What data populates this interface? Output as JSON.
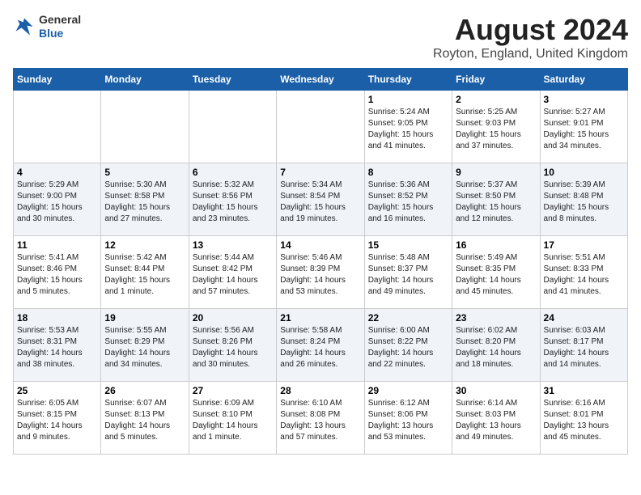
{
  "header": {
    "logo_general": "General",
    "logo_blue": "Blue",
    "title": "August 2024",
    "subtitle": "Royton, England, United Kingdom"
  },
  "days_of_week": [
    "Sunday",
    "Monday",
    "Tuesday",
    "Wednesday",
    "Thursday",
    "Friday",
    "Saturday"
  ],
  "weeks": [
    [
      {
        "num": "",
        "info": ""
      },
      {
        "num": "",
        "info": ""
      },
      {
        "num": "",
        "info": ""
      },
      {
        "num": "",
        "info": ""
      },
      {
        "num": "1",
        "info": "Sunrise: 5:24 AM\nSunset: 9:05 PM\nDaylight: 15 hours\nand 41 minutes."
      },
      {
        "num": "2",
        "info": "Sunrise: 5:25 AM\nSunset: 9:03 PM\nDaylight: 15 hours\nand 37 minutes."
      },
      {
        "num": "3",
        "info": "Sunrise: 5:27 AM\nSunset: 9:01 PM\nDaylight: 15 hours\nand 34 minutes."
      }
    ],
    [
      {
        "num": "4",
        "info": "Sunrise: 5:29 AM\nSunset: 9:00 PM\nDaylight: 15 hours\nand 30 minutes."
      },
      {
        "num": "5",
        "info": "Sunrise: 5:30 AM\nSunset: 8:58 PM\nDaylight: 15 hours\nand 27 minutes."
      },
      {
        "num": "6",
        "info": "Sunrise: 5:32 AM\nSunset: 8:56 PM\nDaylight: 15 hours\nand 23 minutes."
      },
      {
        "num": "7",
        "info": "Sunrise: 5:34 AM\nSunset: 8:54 PM\nDaylight: 15 hours\nand 19 minutes."
      },
      {
        "num": "8",
        "info": "Sunrise: 5:36 AM\nSunset: 8:52 PM\nDaylight: 15 hours\nand 16 minutes."
      },
      {
        "num": "9",
        "info": "Sunrise: 5:37 AM\nSunset: 8:50 PM\nDaylight: 15 hours\nand 12 minutes."
      },
      {
        "num": "10",
        "info": "Sunrise: 5:39 AM\nSunset: 8:48 PM\nDaylight: 15 hours\nand 8 minutes."
      }
    ],
    [
      {
        "num": "11",
        "info": "Sunrise: 5:41 AM\nSunset: 8:46 PM\nDaylight: 15 hours\nand 5 minutes."
      },
      {
        "num": "12",
        "info": "Sunrise: 5:42 AM\nSunset: 8:44 PM\nDaylight: 15 hours\nand 1 minute."
      },
      {
        "num": "13",
        "info": "Sunrise: 5:44 AM\nSunset: 8:42 PM\nDaylight: 14 hours\nand 57 minutes."
      },
      {
        "num": "14",
        "info": "Sunrise: 5:46 AM\nSunset: 8:39 PM\nDaylight: 14 hours\nand 53 minutes."
      },
      {
        "num": "15",
        "info": "Sunrise: 5:48 AM\nSunset: 8:37 PM\nDaylight: 14 hours\nand 49 minutes."
      },
      {
        "num": "16",
        "info": "Sunrise: 5:49 AM\nSunset: 8:35 PM\nDaylight: 14 hours\nand 45 minutes."
      },
      {
        "num": "17",
        "info": "Sunrise: 5:51 AM\nSunset: 8:33 PM\nDaylight: 14 hours\nand 41 minutes."
      }
    ],
    [
      {
        "num": "18",
        "info": "Sunrise: 5:53 AM\nSunset: 8:31 PM\nDaylight: 14 hours\nand 38 minutes."
      },
      {
        "num": "19",
        "info": "Sunrise: 5:55 AM\nSunset: 8:29 PM\nDaylight: 14 hours\nand 34 minutes."
      },
      {
        "num": "20",
        "info": "Sunrise: 5:56 AM\nSunset: 8:26 PM\nDaylight: 14 hours\nand 30 minutes."
      },
      {
        "num": "21",
        "info": "Sunrise: 5:58 AM\nSunset: 8:24 PM\nDaylight: 14 hours\nand 26 minutes."
      },
      {
        "num": "22",
        "info": "Sunrise: 6:00 AM\nSunset: 8:22 PM\nDaylight: 14 hours\nand 22 minutes."
      },
      {
        "num": "23",
        "info": "Sunrise: 6:02 AM\nSunset: 8:20 PM\nDaylight: 14 hours\nand 18 minutes."
      },
      {
        "num": "24",
        "info": "Sunrise: 6:03 AM\nSunset: 8:17 PM\nDaylight: 14 hours\nand 14 minutes."
      }
    ],
    [
      {
        "num": "25",
        "info": "Sunrise: 6:05 AM\nSunset: 8:15 PM\nDaylight: 14 hours\nand 9 minutes."
      },
      {
        "num": "26",
        "info": "Sunrise: 6:07 AM\nSunset: 8:13 PM\nDaylight: 14 hours\nand 5 minutes."
      },
      {
        "num": "27",
        "info": "Sunrise: 6:09 AM\nSunset: 8:10 PM\nDaylight: 14 hours\nand 1 minute."
      },
      {
        "num": "28",
        "info": "Sunrise: 6:10 AM\nSunset: 8:08 PM\nDaylight: 13 hours\nand 57 minutes."
      },
      {
        "num": "29",
        "info": "Sunrise: 6:12 AM\nSunset: 8:06 PM\nDaylight: 13 hours\nand 53 minutes."
      },
      {
        "num": "30",
        "info": "Sunrise: 6:14 AM\nSunset: 8:03 PM\nDaylight: 13 hours\nand 49 minutes."
      },
      {
        "num": "31",
        "info": "Sunrise: 6:16 AM\nSunset: 8:01 PM\nDaylight: 13 hours\nand 45 minutes."
      }
    ]
  ]
}
